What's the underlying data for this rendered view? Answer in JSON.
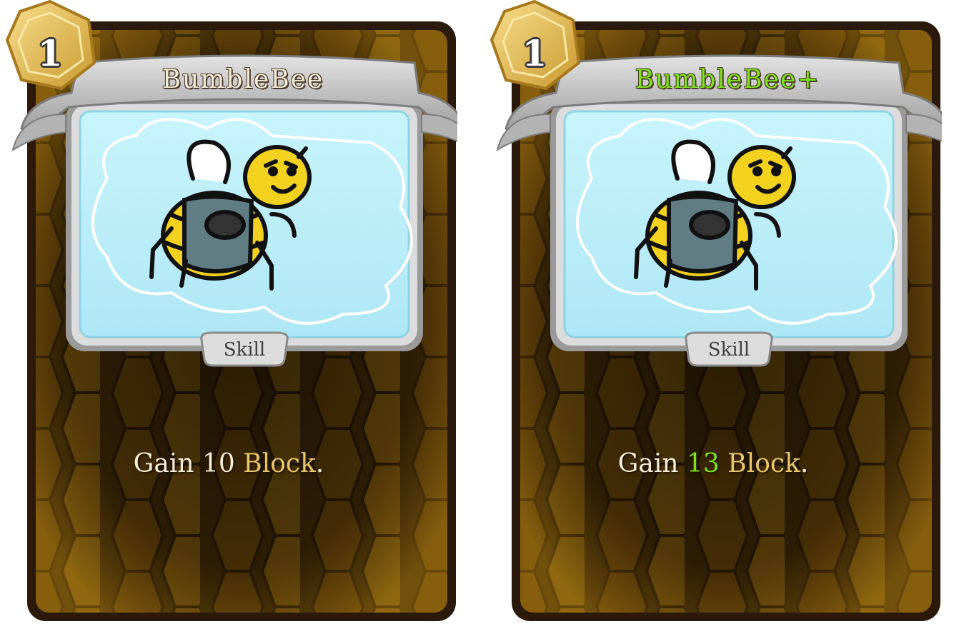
{
  "colors": {
    "base_title": "#f1ead6",
    "upgraded_title": "#7fe11c",
    "body_text": "#f4ecd8",
    "keyword": "#e7c56a",
    "upgraded_value": "#7fe11c",
    "card_border": "#2b1a0b",
    "honeycomb_dark": "#3b2606",
    "honeycomb_light": "#d7a01a",
    "frame_silver": "#c9c9c9",
    "art_sky": "#bff0fb",
    "cost_gold": "#e8c35a"
  },
  "cards": [
    {
      "cost": "1",
      "title": "BumbleBee",
      "type": "Skill",
      "desc_prefix": "Gain ",
      "desc_value": "10",
      "desc_space": " ",
      "desc_keyword": "Block",
      "desc_suffix": ".",
      "upgraded": false
    },
    {
      "cost": "1",
      "title": "BumbleBee+",
      "type": "Skill",
      "desc_prefix": "Gain ",
      "desc_value": "13",
      "desc_space": " ",
      "desc_keyword": "Block",
      "desc_suffix": ".",
      "upgraded": true
    }
  ]
}
